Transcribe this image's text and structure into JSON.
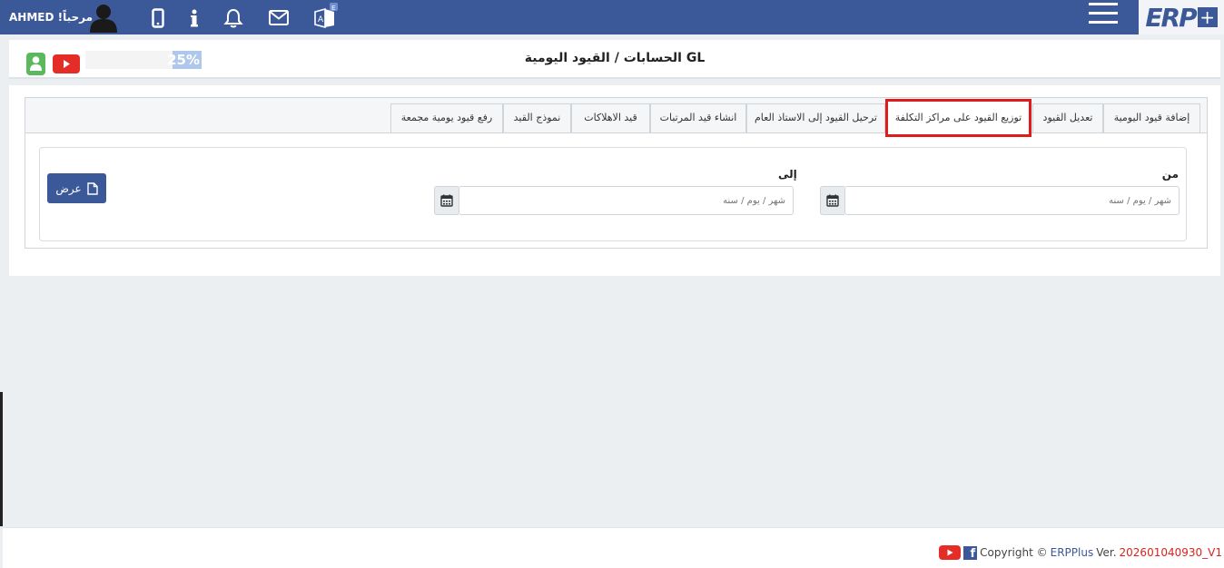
{
  "topbar": {
    "greeting": "!مرحباً",
    "username": "AHMED",
    "logo_text": "ERP",
    "lang_badge": "E"
  },
  "header": {
    "title": "الحسابات / القيود اليومية GL",
    "progress_value": 25,
    "progress_label": "25%"
  },
  "tabs": [
    {
      "label": "إضافة قيود اليومية"
    },
    {
      "label": "تعديل القيود"
    },
    {
      "label": "توزيع القيود على مراكز التكلفة",
      "active": true
    },
    {
      "label": "ترحيل القيود إلى الاستاذ العام"
    },
    {
      "label": "انشاء قيد المرتبات"
    },
    {
      "label": "قيد الاهلاكات"
    },
    {
      "label": "نموذج القيد"
    },
    {
      "label": "رفع قيود يومية مجمعة"
    }
  ],
  "filters": {
    "from_label": "من",
    "to_label": "إلى",
    "from_placeholder": "شهر / يوم / سنه",
    "to_placeholder": "شهر / يوم / سنه",
    "view_label": "عرض"
  },
  "footer": {
    "copyright": "Copyright ©",
    "brand": "ERPPlus",
    "ver_label": "Ver.",
    "version": "202601040930_V1"
  },
  "colors": {
    "primary": "#3b5998",
    "highlight": "#e01b1b",
    "youtube": "#e52d27",
    "user_green": "#5cb85c"
  }
}
